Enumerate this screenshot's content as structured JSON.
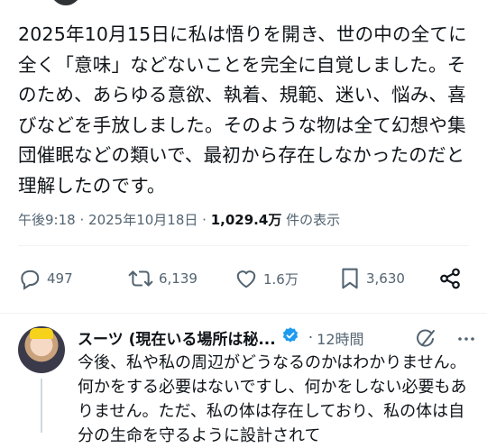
{
  "tweet": {
    "text": "2025年10月15日に私は悟りを開き、世の中の全てに全く「意味」などないことを完全に自覚しました。そのため、あらゆる意欲、執着、規範、迷い、悩み、喜びなどを手放しました。そのような物は全て幻想や集団催眠などの類いで、最初から存在しなかったのだと理解したのです。",
    "time": "午後9:18",
    "separator": "·",
    "date": "2025年10月18日",
    "views_count": "1,029.4万",
    "views_label": "件の表示"
  },
  "actions": {
    "replies": "497",
    "reposts": "6,139",
    "likes": "1.6万",
    "bookmarks": "3,630"
  },
  "reply": {
    "name": "スーツ (現在いる場所は秘...",
    "dot": "·",
    "time": "12時間",
    "text": "今後、私や私の周辺がどうなるのかはわかりません。何かをする必要はないですし、何かをしない必要もありません。ただ、私の体は存在しており、私の体は自分の生命を守るように設計されて"
  },
  "colors": {
    "text": "#0f1419",
    "secondary": "#536471",
    "verified": "#1d9bf0",
    "divider": "#eff3f4"
  }
}
